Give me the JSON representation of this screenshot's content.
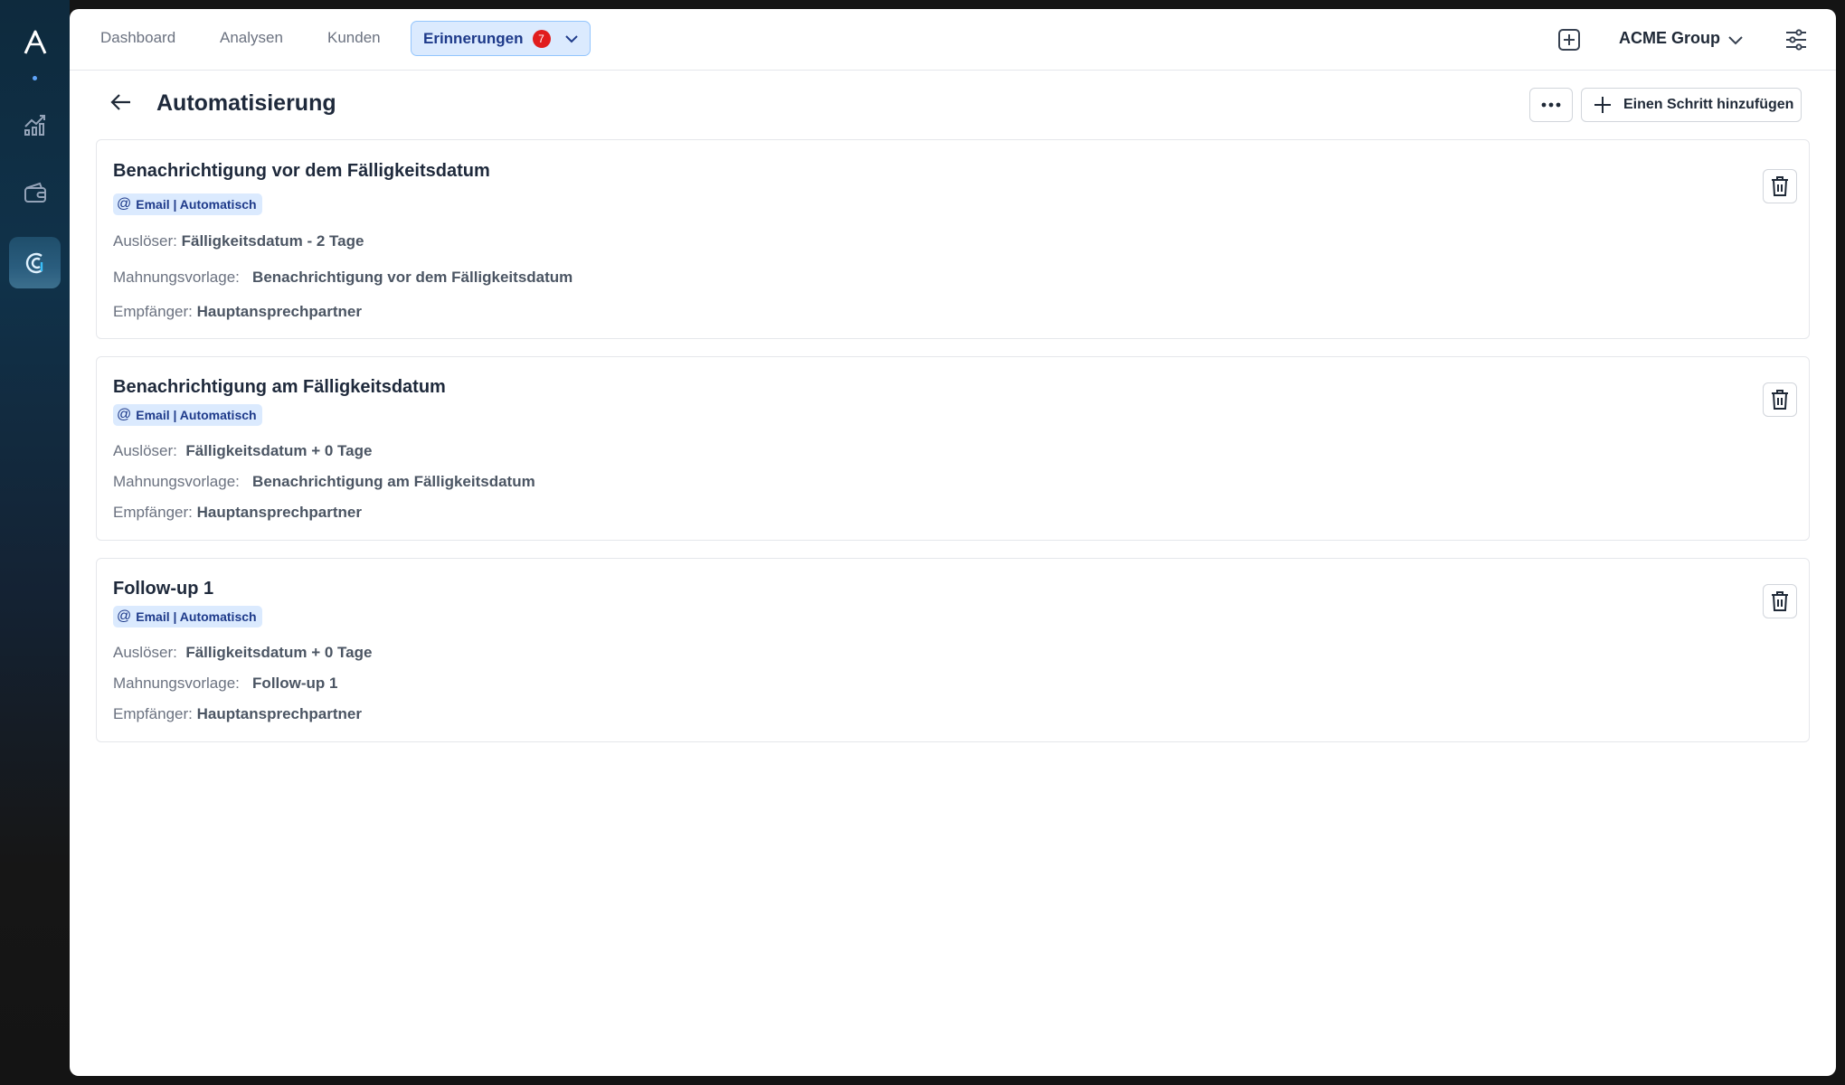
{
  "app": {
    "nav": [
      "Dashboard",
      "Analysen",
      "Kunden"
    ],
    "active_nav": {
      "label": "Erinnerungen",
      "badge": "7"
    },
    "org_name": "ACME Group"
  },
  "page": {
    "title": "Automatisierung",
    "add_step_label": "Einen Schritt hinzufügen"
  },
  "labels": {
    "trigger": "Auslöser:",
    "template": "Mahnungsvorlage:",
    "recipient": "Empfänger:"
  },
  "steps": [
    {
      "title": "Benachrichtigung vor dem Fälligkeitsdatum",
      "chip": "Email | Automatisch",
      "trigger": "Fälligkeitsdatum - 2 Tage",
      "template": "Benachrichtigung vor dem Fälligkeitsdatum",
      "recipient": "Hauptansprechpartner"
    },
    {
      "title": "Benachrichtigung am Fälligkeitsdatum",
      "chip": "Email | Automatisch",
      "trigger": "Fälligkeitsdatum + 0 Tage",
      "template": "Benachrichtigung am Fälligkeitsdatum",
      "recipient": "Hauptansprechpartner"
    },
    {
      "title": "Follow-up 1",
      "chip": "Email | Automatisch",
      "trigger": "Fälligkeitsdatum + 0 Tage",
      "template": "Follow-up 1",
      "recipient": "Hauptansprechpartner"
    }
  ]
}
